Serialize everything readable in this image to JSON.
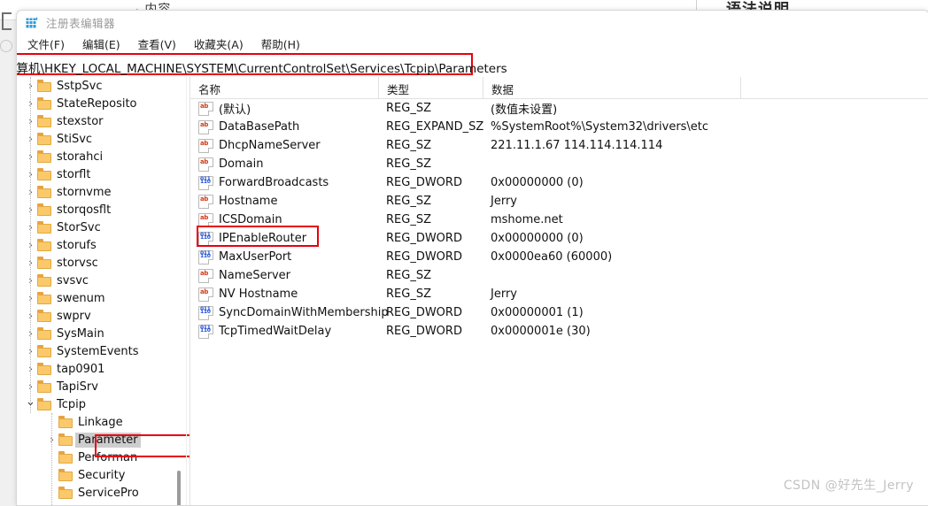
{
  "background": {
    "breadcrumb": "内容",
    "breadcrumb_chevron": "‹",
    "section_heading": "语法说明"
  },
  "window": {
    "title": "注册表编辑器",
    "icon": "registry-editor-icon"
  },
  "menu": {
    "items": [
      {
        "label": "文件(F)",
        "name": "menu-file"
      },
      {
        "label": "编辑(E)",
        "name": "menu-edit"
      },
      {
        "label": "查看(V)",
        "name": "menu-view"
      },
      {
        "label": "收藏夹(A)",
        "name": "menu-favorites"
      },
      {
        "label": "帮助(H)",
        "name": "menu-help"
      }
    ]
  },
  "address_bar": {
    "value": "计算机\\HKEY_LOCAL_MACHINE\\SYSTEM\\CurrentControlSet\\Services\\Tcpip\\Parameters",
    "highlight_color": "#e8000d"
  },
  "tree": {
    "nodes": [
      {
        "label": "SstpSvc",
        "depth": 1,
        "expander": "collapsed",
        "selected": false
      },
      {
        "label": "StateReposito",
        "depth": 1,
        "expander": "collapsed",
        "selected": false
      },
      {
        "label": "stexstor",
        "depth": 1,
        "expander": "collapsed",
        "selected": false
      },
      {
        "label": "StiSvc",
        "depth": 1,
        "expander": "collapsed",
        "selected": false
      },
      {
        "label": "storahci",
        "depth": 1,
        "expander": "collapsed",
        "selected": false
      },
      {
        "label": "storflt",
        "depth": 1,
        "expander": "collapsed",
        "selected": false
      },
      {
        "label": "stornvme",
        "depth": 1,
        "expander": "collapsed",
        "selected": false
      },
      {
        "label": "storqosflt",
        "depth": 1,
        "expander": "collapsed",
        "selected": false
      },
      {
        "label": "StorSvc",
        "depth": 1,
        "expander": "collapsed",
        "selected": false
      },
      {
        "label": "storufs",
        "depth": 1,
        "expander": "collapsed",
        "selected": false
      },
      {
        "label": "storvsc",
        "depth": 1,
        "expander": "collapsed",
        "selected": false
      },
      {
        "label": "svsvc",
        "depth": 1,
        "expander": "collapsed",
        "selected": false
      },
      {
        "label": "swenum",
        "depth": 1,
        "expander": "collapsed",
        "selected": false
      },
      {
        "label": "swprv",
        "depth": 1,
        "expander": "collapsed",
        "selected": false
      },
      {
        "label": "SysMain",
        "depth": 1,
        "expander": "collapsed",
        "selected": false
      },
      {
        "label": "SystemEvents",
        "depth": 1,
        "expander": "collapsed",
        "selected": false
      },
      {
        "label": "tap0901",
        "depth": 1,
        "expander": "collapsed",
        "selected": false
      },
      {
        "label": "TapiSrv",
        "depth": 1,
        "expander": "collapsed",
        "selected": false
      },
      {
        "label": "Tcpip",
        "depth": 1,
        "expander": "expanded",
        "selected": false
      },
      {
        "label": "Linkage",
        "depth": 2,
        "expander": "none",
        "selected": false
      },
      {
        "label": "Parameter",
        "depth": 2,
        "expander": "collapsed",
        "selected": true
      },
      {
        "label": "Performan",
        "depth": 2,
        "expander": "none",
        "selected": false
      },
      {
        "label": "Security",
        "depth": 2,
        "expander": "none",
        "selected": false
      },
      {
        "label": "ServicePro",
        "depth": 2,
        "expander": "none",
        "selected": false
      }
    ],
    "highlight_color": "#e8000d",
    "scrollbar": "tree-vertical-scrollbar"
  },
  "list": {
    "columns": [
      {
        "label": "名称",
        "name": "column-header-name"
      },
      {
        "label": "类型",
        "name": "column-header-type"
      },
      {
        "label": "数据",
        "name": "column-header-data"
      }
    ],
    "rows": [
      {
        "name": "(默认)",
        "icon": "string-value-icon",
        "type": "REG_SZ",
        "data": "(数值未设置)"
      },
      {
        "name": "DataBasePath",
        "icon": "string-value-icon",
        "type": "REG_EXPAND_SZ",
        "data": "%SystemRoot%\\System32\\drivers\\etc"
      },
      {
        "name": "DhcpNameServer",
        "icon": "string-value-icon",
        "type": "REG_SZ",
        "data": "221.11.1.67 114.114.114.114"
      },
      {
        "name": "Domain",
        "icon": "string-value-icon",
        "type": "REG_SZ",
        "data": ""
      },
      {
        "name": "ForwardBroadcasts",
        "icon": "dword-value-icon",
        "type": "REG_DWORD",
        "data": "0x00000000 (0)"
      },
      {
        "name": "Hostname",
        "icon": "string-value-icon",
        "type": "REG_SZ",
        "data": "Jerry"
      },
      {
        "name": "ICSDomain",
        "icon": "string-value-icon",
        "type": "REG_SZ",
        "data": "mshome.net"
      },
      {
        "name": "IPEnableRouter",
        "icon": "dword-value-icon",
        "type": "REG_DWORD",
        "data": "0x00000000 (0)"
      },
      {
        "name": "MaxUserPort",
        "icon": "dword-value-icon",
        "type": "REG_DWORD",
        "data": "0x0000ea60 (60000)"
      },
      {
        "name": "NameServer",
        "icon": "string-value-icon",
        "type": "REG_SZ",
        "data": ""
      },
      {
        "name": "NV Hostname",
        "icon": "string-value-icon",
        "type": "REG_SZ",
        "data": "Jerry"
      },
      {
        "name": "SyncDomainWithMembership",
        "icon": "dword-value-icon",
        "type": "REG_DWORD",
        "data": "0x00000001 (1)"
      },
      {
        "name": "TcpTimedWaitDelay",
        "icon": "dword-value-icon",
        "type": "REG_DWORD",
        "data": "0x0000001e (30)"
      }
    ],
    "highlighted_row": "IPEnableRouter",
    "highlight_color": "#e8000d"
  },
  "watermark": {
    "text": "CSDN @好先生_Jerry"
  }
}
